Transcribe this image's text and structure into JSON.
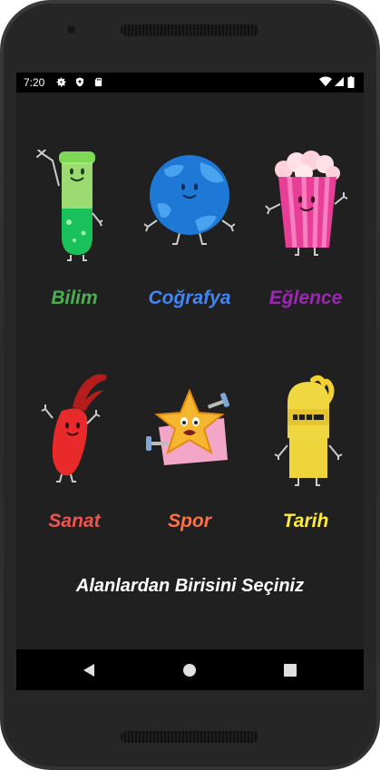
{
  "statusbar": {
    "time": "7:20"
  },
  "categories": [
    {
      "label": "Bilim",
      "color": "#4caf50",
      "icon": "test-tube-character-icon"
    },
    {
      "label": "Coğrafya",
      "color": "#4285f4",
      "icon": "globe-character-icon"
    },
    {
      "label": "Eğlence",
      "color": "#9c27b0",
      "icon": "popcorn-character-icon"
    },
    {
      "label": "Sanat",
      "color": "#ef5350",
      "icon": "paintbrush-character-icon"
    },
    {
      "label": "Spor",
      "color": "#ff7043",
      "icon": "star-dumbbell-character-icon"
    },
    {
      "label": "Tarih",
      "color": "#ffeb3b",
      "icon": "knight-helmet-character-icon"
    }
  ],
  "prompt": "Alanlardan Birisini Seçiniz",
  "navbar": {
    "back": "back-icon",
    "home": "home-icon",
    "recents": "recents-icon"
  }
}
